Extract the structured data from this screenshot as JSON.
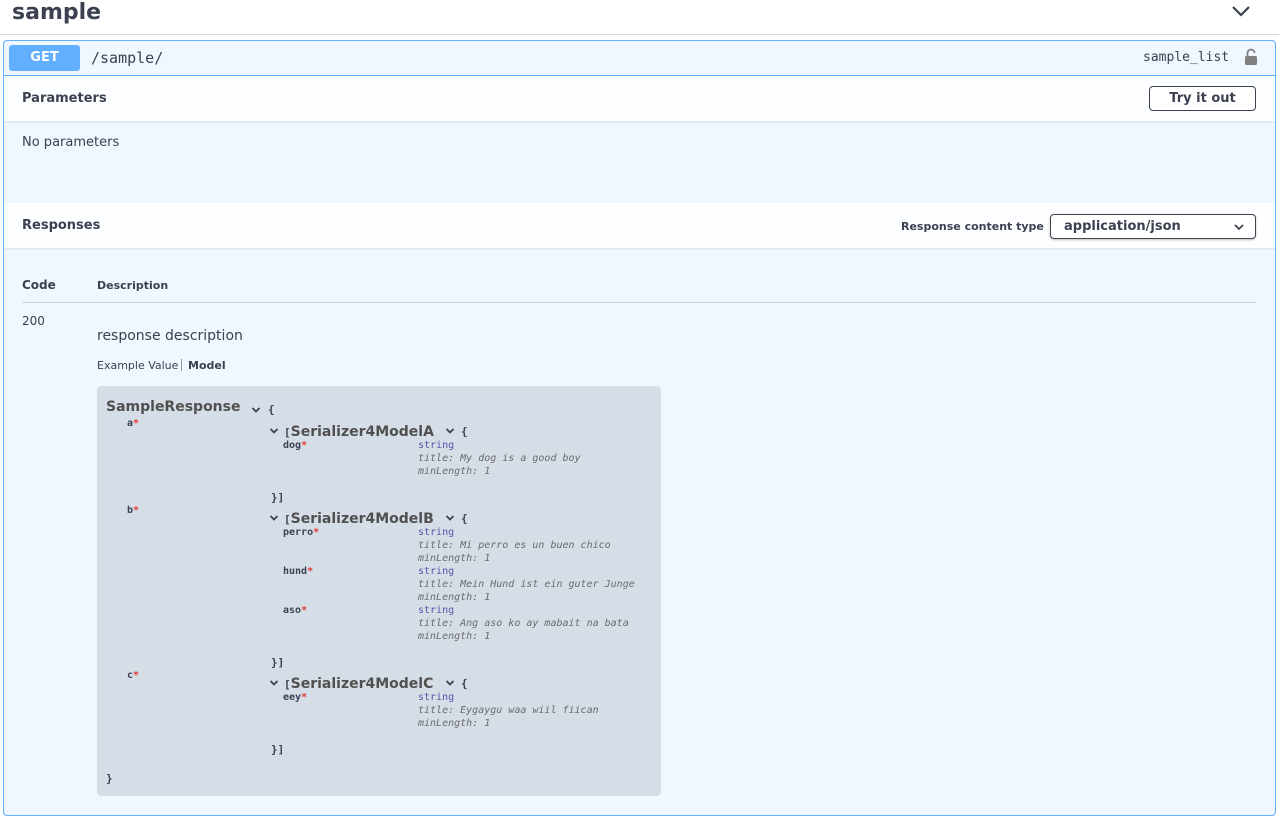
{
  "tag": {
    "title": "sample"
  },
  "operation": {
    "method": "GET",
    "path": "/sample/",
    "operation_id": "sample_list"
  },
  "parameters": {
    "title": "Parameters",
    "try_button": "Try it out",
    "empty_text": "No parameters"
  },
  "responses": {
    "title": "Responses",
    "content_type_label": "Response content type",
    "content_type_value": "application/json",
    "columns": {
      "code": "Code",
      "description": "Description"
    },
    "rows": [
      {
        "code": "200",
        "description": "response description"
      }
    ],
    "tabs": {
      "example": "Example Value",
      "model": "Model"
    }
  },
  "model": {
    "name": "SampleResponse",
    "open_brace": "{",
    "close_brace": "}",
    "req_mark": "*",
    "props": [
      {
        "name": "a",
        "ref_prefix": "[",
        "ref_name": "Serializer4ModelA",
        "ref_open": "{",
        "ref_close": "}]",
        "fields": [
          {
            "name": "dog",
            "type": "string",
            "title": "title: My dog is a good boy",
            "min": "minLength: 1"
          }
        ]
      },
      {
        "name": "b",
        "ref_prefix": "[",
        "ref_name": "Serializer4ModelB",
        "ref_open": "{",
        "ref_close": "}]",
        "fields": [
          {
            "name": "perro",
            "type": "string",
            "title": "title: Mi perro es un buen chico",
            "min": "minLength: 1"
          },
          {
            "name": "hund",
            "type": "string",
            "title": "title: Mein Hund ist ein guter Junge",
            "min": "minLength: 1"
          },
          {
            "name": "aso",
            "type": "string",
            "title": "title: Ang aso ko ay mabait na bata",
            "min": "minLength: 1"
          }
        ]
      },
      {
        "name": "c",
        "ref_prefix": "[",
        "ref_name": "Serializer4ModelC",
        "ref_open": "{",
        "ref_close": "}]",
        "fields": [
          {
            "name": "eey",
            "type": "string",
            "title": "title: Eygaygu waa wiil fiican",
            "min": "minLength: 1"
          }
        ]
      }
    ]
  },
  "colors": {
    "get_accent": "#61affe",
    "text": "#3b4151",
    "required": "#e53935"
  },
  "icons": {
    "tag_toggle": "chevron-down-icon",
    "auth": "lock-icon",
    "select": "chevron-down-icon",
    "model_toggle": "chevron-down-icon"
  }
}
